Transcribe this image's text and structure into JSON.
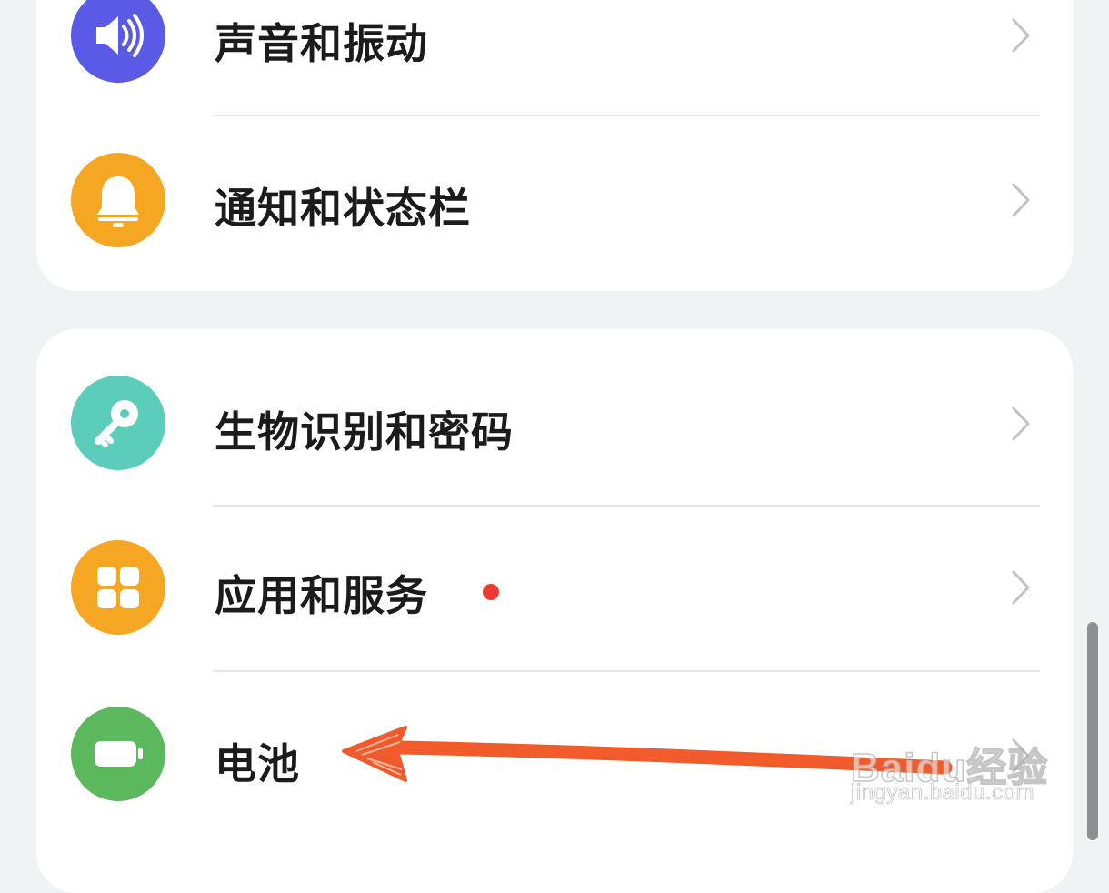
{
  "settings": {
    "groups": [
      {
        "items": [
          {
            "label": "声音和振动",
            "icon": "speaker-icon",
            "icon_color": "#5a5ae6"
          },
          {
            "label": "通知和状态栏",
            "icon": "bell-icon",
            "icon_color": "#f5a623"
          }
        ]
      },
      {
        "items": [
          {
            "label": "生物识别和密码",
            "icon": "key-icon",
            "icon_color": "#5ccdbb"
          },
          {
            "label": "应用和服务",
            "icon": "apps-grid-icon",
            "icon_color": "#f5a623",
            "has_badge_dot": true,
            "badge_color": "#ee3a32"
          },
          {
            "label": "电池",
            "icon": "battery-icon",
            "icon_color": "#5cb85c"
          }
        ]
      }
    ]
  },
  "annotation": {
    "arrow_color": "#f15a2b",
    "points_to": "电池"
  },
  "watermark": {
    "logo": "Baidu经验",
    "url": "jingyan.baidu.com"
  }
}
